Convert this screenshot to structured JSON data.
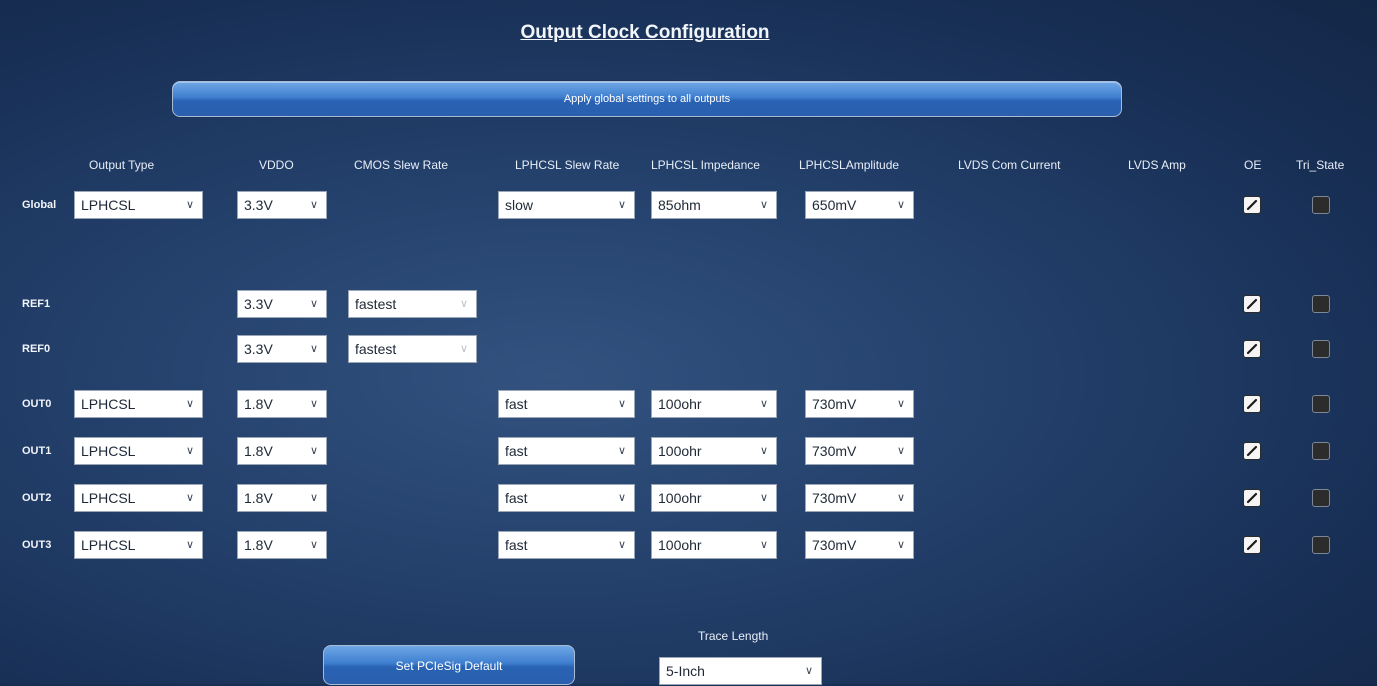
{
  "title": "Output Clock Configuration",
  "apply_button": "Apply global settings to all outputs",
  "headers": {
    "output_type": "Output Type",
    "vddo": "VDDO",
    "cmos_slew": "CMOS Slew Rate",
    "lphcsl_slew": "LPHCSL Slew Rate",
    "lphcsl_imp": "LPHCSL Impedance",
    "lphcsl_amp": "LPHCSLAmplitude",
    "lvds_com": "LVDS Com Current",
    "lvds_amp": "LVDS Amp",
    "oe": "OE",
    "tri_state": "Tri_State"
  },
  "rows": [
    {
      "label": "Global",
      "output_type": "LPHCSL",
      "vddo": "3.3V",
      "cmos_slew": null,
      "lphcsl_slew": "slow",
      "lphcsl_imp": "85ohm",
      "lphcsl_amp": "650mV",
      "oe": true,
      "tri_state": false
    },
    {
      "label": "REF1",
      "output_type": null,
      "vddo": "3.3V",
      "cmos_slew": "fastest",
      "lphcsl_slew": null,
      "lphcsl_imp": null,
      "lphcsl_amp": null,
      "oe": true,
      "tri_state": false
    },
    {
      "label": "REF0",
      "output_type": null,
      "vddo": "3.3V",
      "cmos_slew": "fastest",
      "lphcsl_slew": null,
      "lphcsl_imp": null,
      "lphcsl_amp": null,
      "oe": true,
      "tri_state": false
    },
    {
      "label": "OUT0",
      "output_type": "LPHCSL",
      "vddo": "1.8V",
      "cmos_slew": null,
      "lphcsl_slew": "fast",
      "lphcsl_imp": "100ohr",
      "lphcsl_amp": "730mV",
      "oe": true,
      "tri_state": false
    },
    {
      "label": "OUT1",
      "output_type": "LPHCSL",
      "vddo": "1.8V",
      "cmos_slew": null,
      "lphcsl_slew": "fast",
      "lphcsl_imp": "100ohr",
      "lphcsl_amp": "730mV",
      "oe": true,
      "tri_state": false
    },
    {
      "label": "OUT2",
      "output_type": "LPHCSL",
      "vddo": "1.8V",
      "cmos_slew": null,
      "lphcsl_slew": "fast",
      "lphcsl_imp": "100ohr",
      "lphcsl_amp": "730mV",
      "oe": true,
      "tri_state": false
    },
    {
      "label": "OUT3",
      "output_type": "LPHCSL",
      "vddo": "1.8V",
      "cmos_slew": null,
      "lphcsl_slew": "fast",
      "lphcsl_imp": "100ohr",
      "lphcsl_amp": "730mV",
      "oe": true,
      "tri_state": false
    }
  ],
  "pcie_button": "Set PCIeSig Default",
  "trace_length": {
    "label": "Trace Length",
    "value": "5-Inch"
  },
  "icons": {
    "dropdown": "chevron-down-icon",
    "check": "checkmark-icon"
  },
  "colors": {
    "button_blue": "#3f7fd0",
    "background": "#1e3a63"
  }
}
